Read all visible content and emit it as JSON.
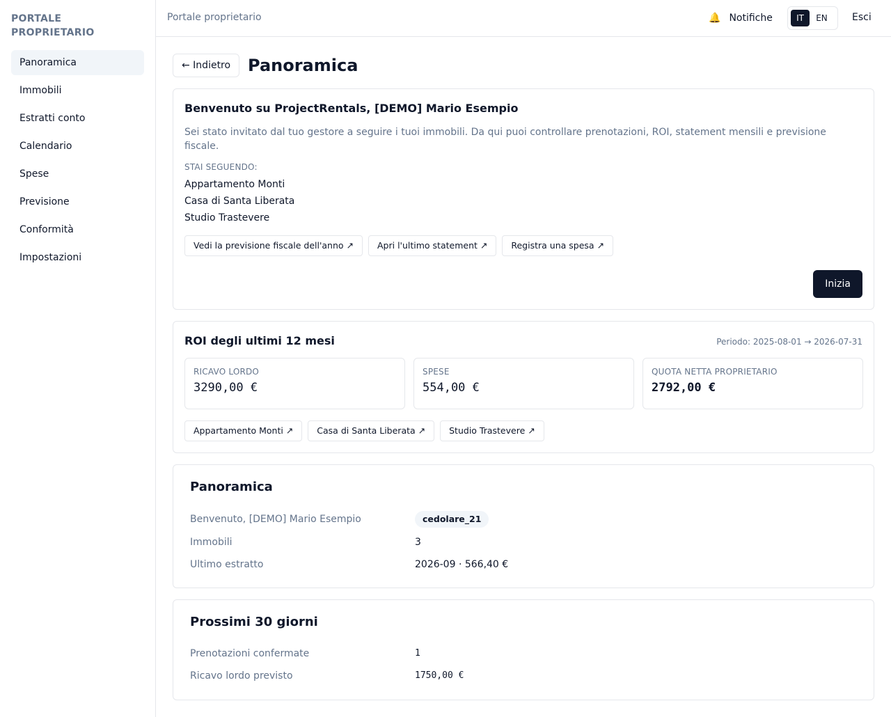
{
  "sidebar": {
    "brand": "PORTALE PROPRIETARIO",
    "items": [
      {
        "label": "Panoramica"
      },
      {
        "label": "Immobili"
      },
      {
        "label": "Estratti conto"
      },
      {
        "label": "Calendario"
      },
      {
        "label": "Spese"
      },
      {
        "label": "Previsione"
      },
      {
        "label": "Conformità"
      },
      {
        "label": "Impostazioni"
      }
    ]
  },
  "topbar": {
    "breadcrumb": "Portale proprietario",
    "notifications_label": "Notifiche",
    "bell_icon": "🔔",
    "languages": [
      "IT",
      "EN"
    ],
    "active_language": "IT",
    "logout_label": "Esci"
  },
  "header": {
    "back_label": "← Indietro",
    "title": "Panoramica"
  },
  "welcome": {
    "title": "Benvenuto su ProjectRentals, [DEMO] Mario Esempio",
    "description": "Sei stato invitato dal tuo gestore a seguire i tuoi immobili. Da qui puoi controllare prenotazioni, ROI, statement mensili e previsione fiscale.",
    "following_label": "STAI SEGUENDO:",
    "properties": [
      "Appartamento Monti",
      "Casa di Santa Liberata",
      "Studio Trastevere"
    ],
    "actions": [
      "Vedi la previsione fiscale dell'anno ↗",
      "Apri l'ultimo statement ↗",
      "Registra una spesa ↗"
    ],
    "start_label": "Inizia"
  },
  "roi": {
    "title": "ROI degli ultimi 12 mesi",
    "period": "Periodo: 2025-08-01 → 2026-07-31",
    "stats": [
      {
        "label": "RICAVO LORDO",
        "value": "3290,00 €"
      },
      {
        "label": "SPESE",
        "value": "554,00 €"
      },
      {
        "label": "QUOTA NETTA PROPRIETARIO",
        "value": "2792,00 €"
      }
    ],
    "property_links": [
      "Appartamento Monti ↗",
      "Casa di Santa Liberata ↗",
      "Studio Trastevere ↗"
    ]
  },
  "overview": {
    "title": "Panoramica",
    "welcome_label": "Benvenuto, [DEMO] Mario Esempio",
    "tax_regime": "cedolare_21",
    "properties_label": "Immobili",
    "properties_count": "3",
    "last_statement_label": "Ultimo estratto",
    "last_statement_value": "2026-09 · 566,40 €"
  },
  "next30": {
    "title": "Prossimi 30 giorni",
    "confirmed_label": "Prenotazioni confermate",
    "confirmed_value": "1",
    "revenue_label": "Ricavo lordo previsto",
    "revenue_value": "1750,00 €"
  }
}
